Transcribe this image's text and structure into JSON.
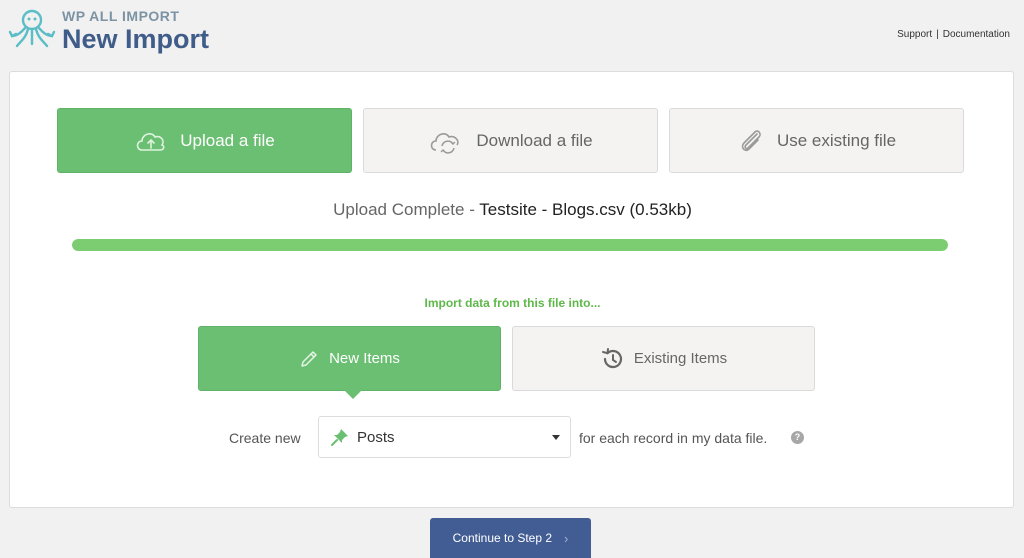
{
  "brand": {
    "product": "WP ALL IMPORT",
    "title": "New Import"
  },
  "top_links": {
    "support": "Support",
    "separator": "|",
    "documentation": "Documentation"
  },
  "source_options": [
    {
      "label": "Upload a file",
      "icon": "cloud-upload-icon",
      "active": true
    },
    {
      "label": "Download a file",
      "icon": "cloud-sync-icon",
      "active": false
    },
    {
      "label": "Use existing file",
      "icon": "paperclip-icon",
      "active": false
    }
  ],
  "upload": {
    "status": "Upload Complete",
    "separator": " - ",
    "filename": "Testsite - Blogs.csv (0.53kb)",
    "progress": 1.0
  },
  "import_target": {
    "prompt": "Import data from this file into...",
    "options": [
      {
        "label": "New Items",
        "icon": "pencil-icon",
        "active": true
      },
      {
        "label": "Existing Items",
        "icon": "history-icon",
        "active": false
      }
    ]
  },
  "create": {
    "prefix": "Create new",
    "selected": "Posts",
    "suffix": "for each record in my data file.",
    "help": "?"
  },
  "continue_button": {
    "label": "Continue to Step 2",
    "chevron": "›"
  },
  "colors": {
    "accent_green": "#6bbf72",
    "brand_blue": "#3f5d88",
    "button_blue": "#425d94",
    "progress_green": "#7ccd72"
  }
}
